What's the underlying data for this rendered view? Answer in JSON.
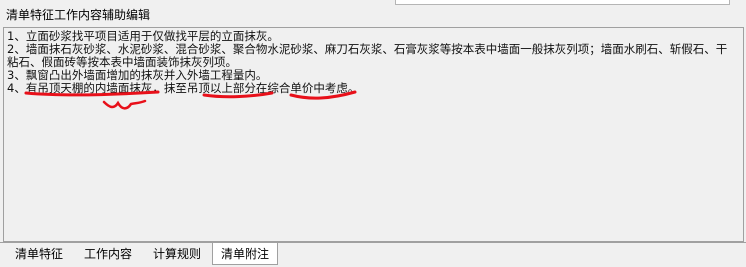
{
  "window": {
    "title": "清单特征工作内容辅助编辑"
  },
  "editor": {
    "lines": [
      "1、立面砂浆找平项目适用于仅做找平层的立面抹灰。",
      "2、墙面抹石灰砂浆、水泥砂浆、混合砂浆、聚合物水泥砂浆、麻刀石灰浆、石膏灰浆等按本表中墙面一般抹灰列项；墙面水刷石、斩假石、干粘石、假面砖等按本表中墙面装饰抹灰列项。",
      "3、飘窗凸出外墙面增加的抹灰并入外墙工程量内。",
      "4、有吊顶天棚的内墙面抹灰，抹至吊顶以上部分在综合单价中考虑。"
    ]
  },
  "tabs": [
    {
      "label": "清单特征"
    },
    {
      "label": "工作内容"
    },
    {
      "label": "计算规则"
    },
    {
      "label": "清单附注",
      "active": true
    }
  ],
  "annotation_color": "#e8101a"
}
